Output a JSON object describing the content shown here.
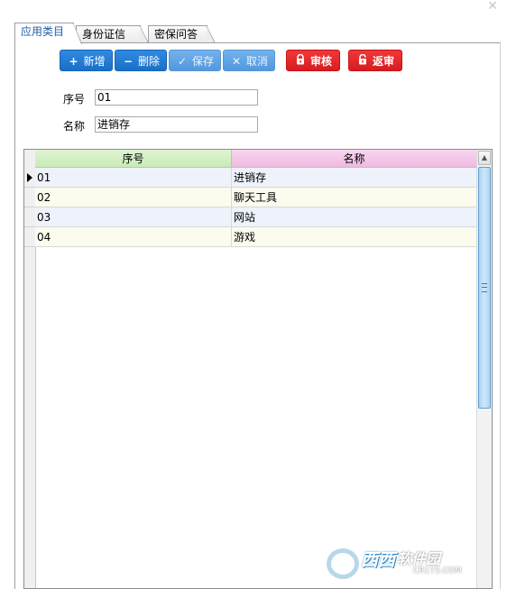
{
  "window": {
    "close_glyph": "✕"
  },
  "tabs": [
    {
      "label": "应用类目",
      "active": true
    },
    {
      "label": "身份证信息",
      "active": false
    },
    {
      "label": "密保问答",
      "active": false
    }
  ],
  "toolbar": {
    "add_label": "新增",
    "delete_label": "删除",
    "save_label": "保存",
    "cancel_label": "取消",
    "approve_label": "审核",
    "unapprove_label": "返审"
  },
  "form": {
    "code_label": "序号",
    "code_value": "01",
    "name_label": "名称",
    "name_value": "进销存"
  },
  "grid": {
    "columns": [
      "序号",
      "名称"
    ],
    "rows": [
      {
        "code": "01",
        "name": "进销存"
      },
      {
        "code": "02",
        "name": "聊天工具"
      },
      {
        "code": "03",
        "name": "网站"
      },
      {
        "code": "04",
        "name": "游戏"
      }
    ]
  },
  "watermark": {
    "brand": "西西",
    "suffix": "软件园",
    "sub": "CR173.COM"
  },
  "colors": {
    "primary": "#1a6fc7",
    "danger": "#d71c1f",
    "tab_active_text": "#1f5fa8"
  }
}
